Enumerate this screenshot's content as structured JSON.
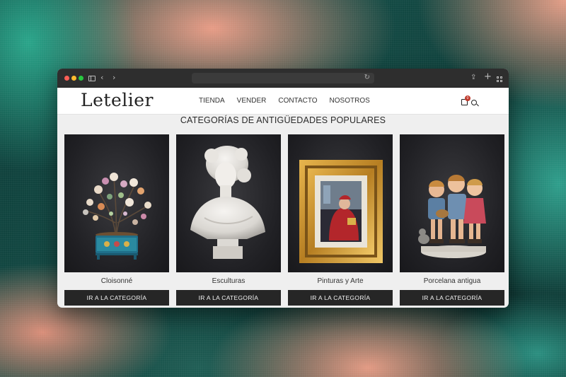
{
  "site": {
    "logo": "Letelier",
    "nav": [
      "TIENDA",
      "VENDER",
      "CONTACTO",
      "NOSOTROS"
    ],
    "cart_count": "0"
  },
  "section_title": "CATEGORÍAS DE ANTIGÜEDADES POPULARES",
  "categories": [
    {
      "name": "Cloisonné",
      "button": "IR A LA CATEGORÍA"
    },
    {
      "name": "Esculturas",
      "button": "IR A LA CATEGORÍA"
    },
    {
      "name": "Pinturas y Arte",
      "button": "IR A LA CATEGORÍA"
    },
    {
      "name": "Porcelana antigua",
      "button": "IR A LA CATEGORÍA"
    }
  ],
  "colors": {
    "titlebar": "#2e2e2e",
    "page_bg": "#efefef",
    "button_bg": "#262626",
    "badge": "#c0392b"
  }
}
